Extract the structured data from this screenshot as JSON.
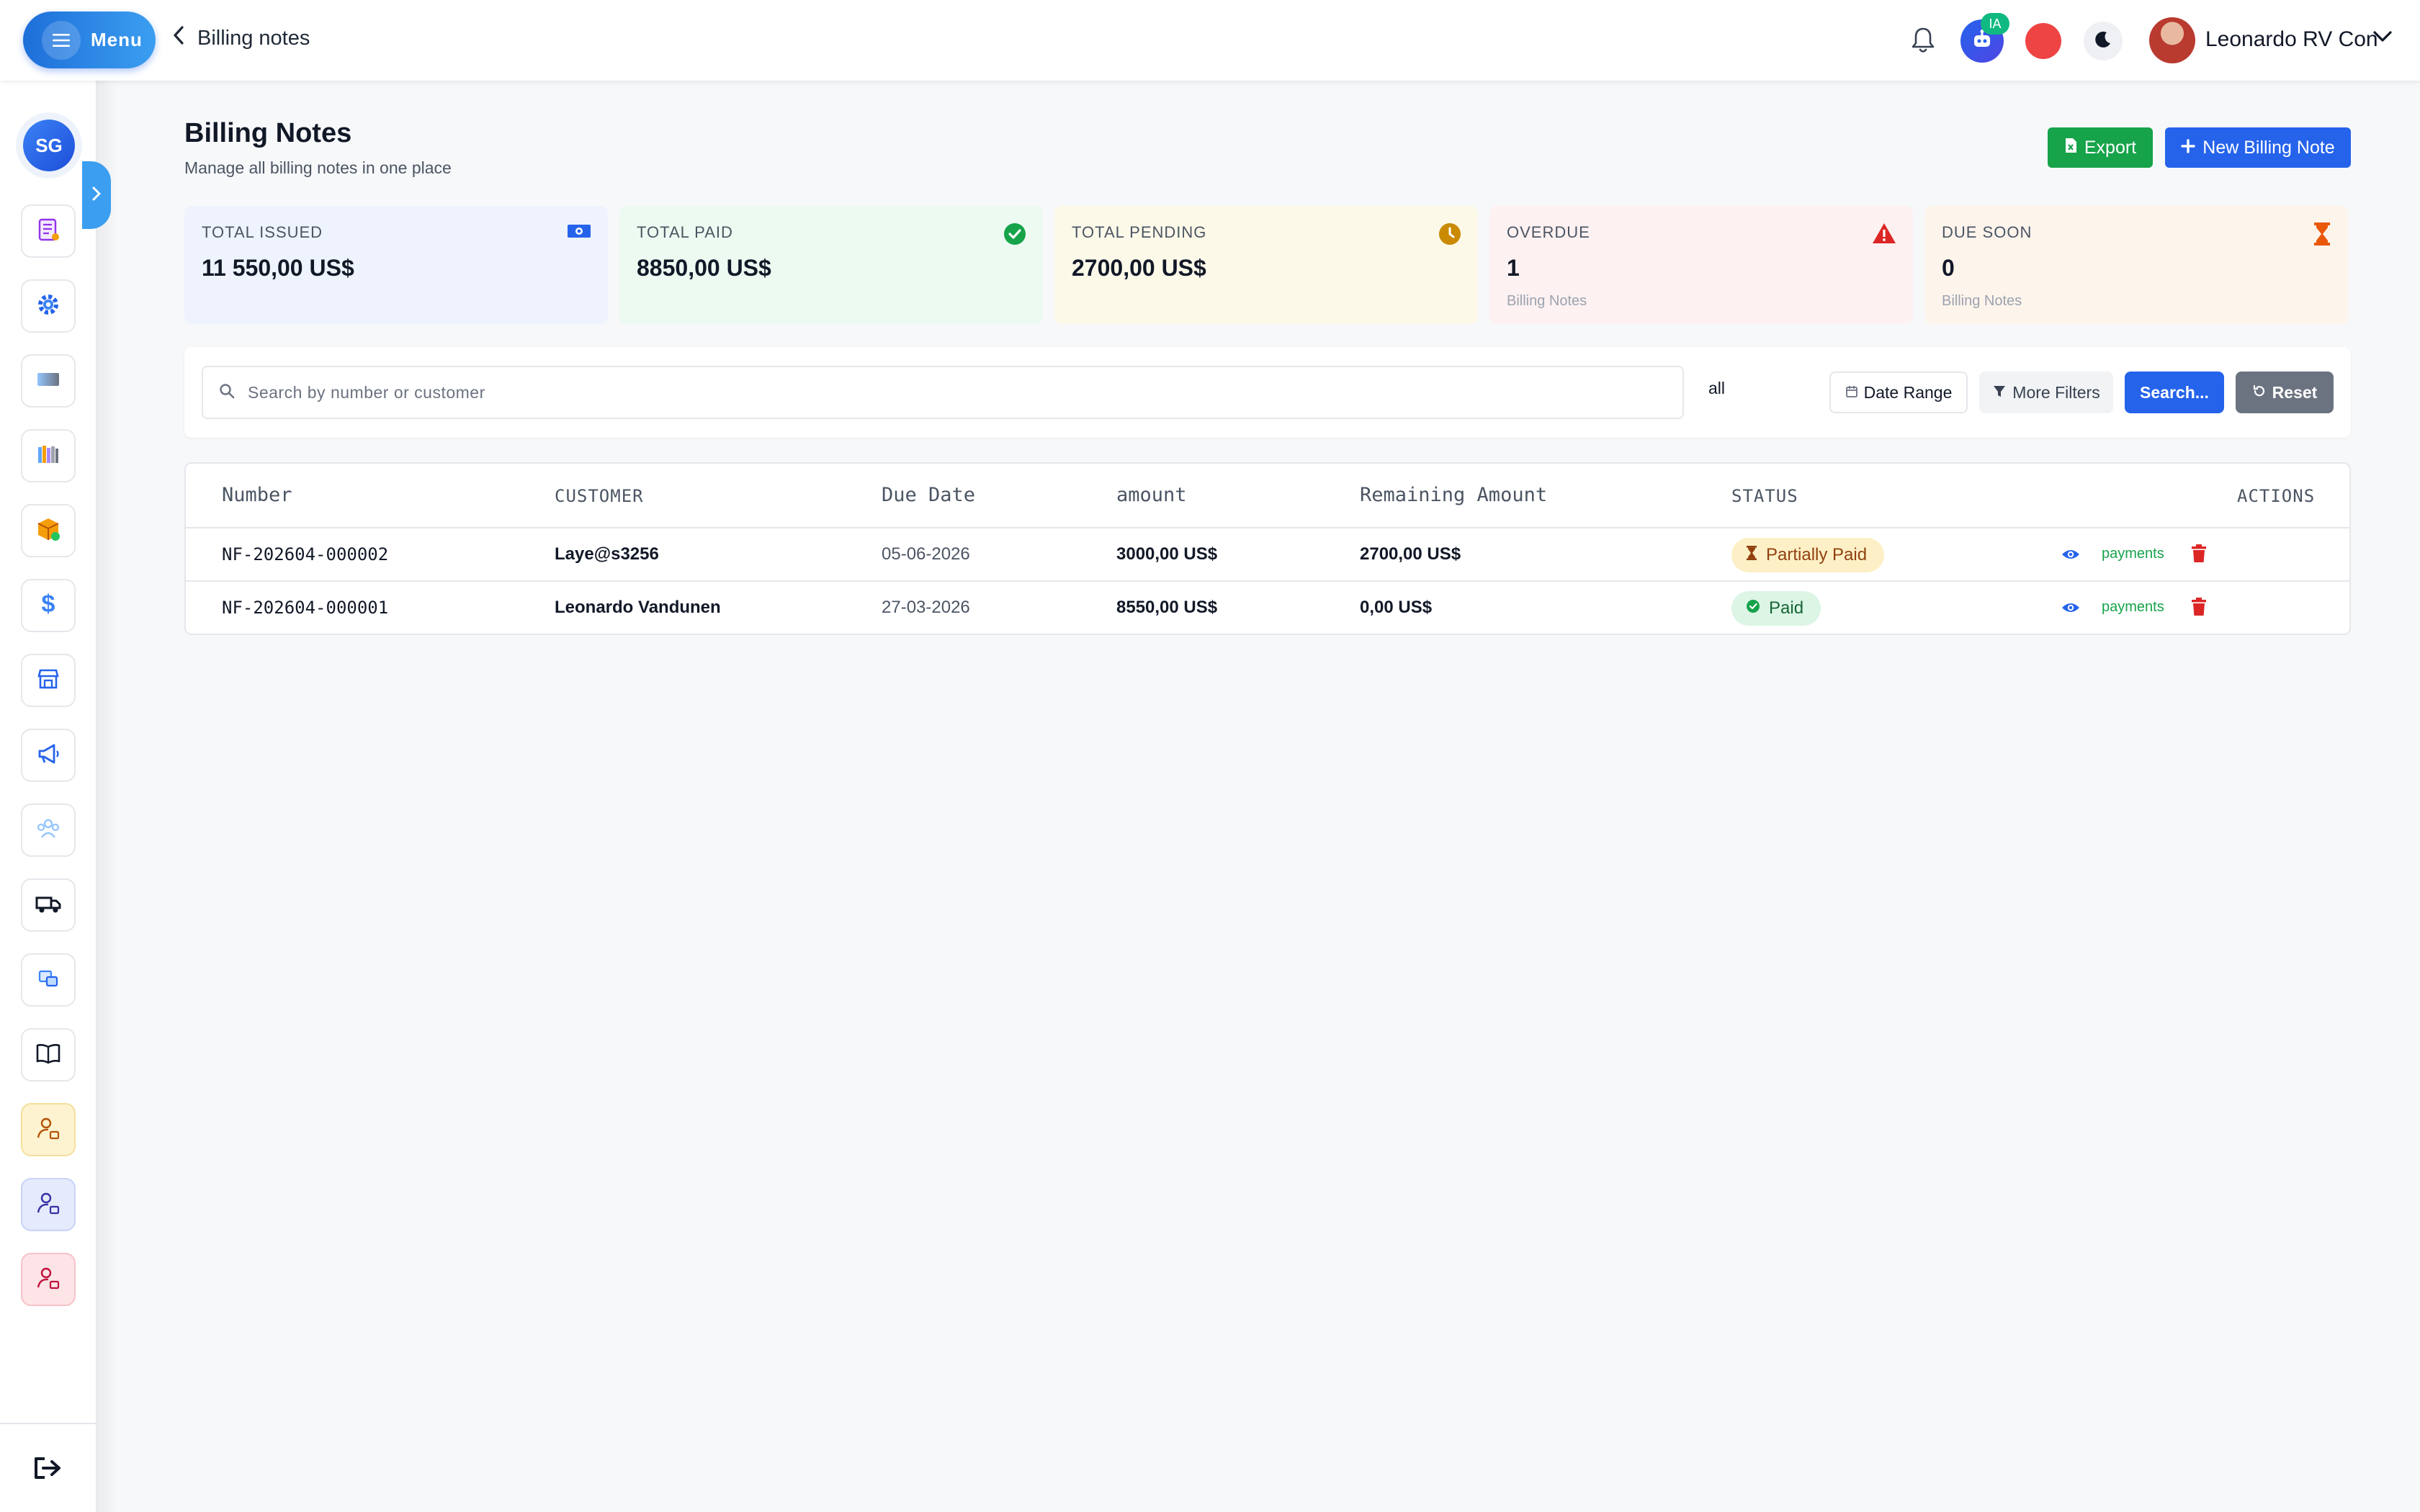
{
  "header": {
    "menu_label": "Menu",
    "page_name": "Billing notes",
    "ai_badge": "IA",
    "user_name": "Leonardo RV Con"
  },
  "sidebar": {
    "company_initials": "SG"
  },
  "page": {
    "title": "Billing Notes",
    "subtitle": "Manage all billing notes in one place",
    "export_label": "Export",
    "new_label": "New Billing Note"
  },
  "stats": [
    {
      "label": "TOTAL ISSUED",
      "value": "11 550,00 US$",
      "sub": "",
      "bg": "#eef3fd",
      "icon": "money-icon"
    },
    {
      "label": "TOTAL PAID",
      "value": "8850,00 US$",
      "sub": "",
      "bg": "#ecfaf1",
      "icon": "check-circle-icon"
    },
    {
      "label": "TOTAL PENDING",
      "value": "2700,00 US$",
      "sub": "",
      "bg": "#fdf9e9",
      "icon": "clock-icon"
    },
    {
      "label": "OVERDUE",
      "value": "1",
      "sub": "Billing Notes",
      "bg": "#fdf1f1",
      "icon": "warning-icon"
    },
    {
      "label": "DUE SOON",
      "value": "0",
      "sub": "Billing Notes",
      "bg": "#fdf4ec",
      "icon": "hourglass-icon"
    }
  ],
  "filters": {
    "search_placeholder": "Search by number or customer",
    "status_value": "all",
    "date_range": "Date Range",
    "more_filters": "More Filters",
    "search": "Search...",
    "reset": "Reset"
  },
  "table": {
    "columns": [
      "Number",
      "CUSTOMER",
      "Due Date",
      "amount",
      "Remaining Amount",
      "STATUS",
      "ACTIONS"
    ],
    "rows": [
      {
        "number": "NF-202604-000002",
        "customer": "Laye@s3256",
        "due_date": "05-06-2026",
        "amount": "3000,00 US$",
        "remaining": "2700,00 US$",
        "status": "Partially Paid",
        "payments": "payments"
      },
      {
        "number": "NF-202604-000001",
        "customer": "Leonardo Vandunen",
        "due_date": "27-03-2026",
        "amount": "8550,00 US$",
        "remaining": "0,00 US$",
        "status": "Paid",
        "payments": "payments"
      }
    ]
  },
  "colors": {
    "primary": "#2563eb",
    "success": "#16a34a",
    "danger": "#dc2626",
    "warning": "#d97706"
  }
}
